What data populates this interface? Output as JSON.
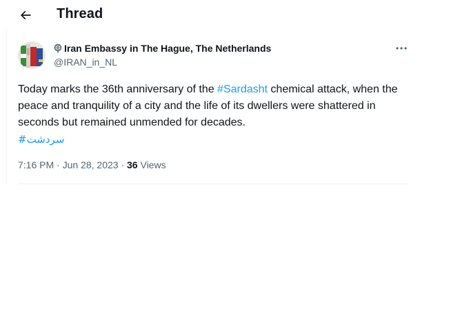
{
  "header": {
    "title": "Thread",
    "back_icon": "arrow-left-icon"
  },
  "tweet": {
    "author": {
      "display_name": "Iran Embassy in The Hague, The Netherlands",
      "handle": "@IRAN_in_NL",
      "badge_icon": "government-label-icon",
      "avatar": "embassy-avatar"
    },
    "text": {
      "part1": "Today marks the 36th anniversary of the ",
      "hashtag1": "#Sardasht",
      "part2": " chemical attack, when the peace and tranquility of a city and the life of its dwellers were shattered in seconds but remained unmended for decades.",
      "hashtag2": "#سردشت"
    },
    "time": "7:16 PM",
    "separator": "·",
    "date": "Jun 28, 2023",
    "views_count": "36",
    "views_label": "Views",
    "more_icon": "more-horizontal-icon"
  },
  "colors": {
    "text_primary": "#0f1419",
    "text_secondary": "#536471",
    "link": "#1d9bf0",
    "divider": "#eff3f4"
  }
}
